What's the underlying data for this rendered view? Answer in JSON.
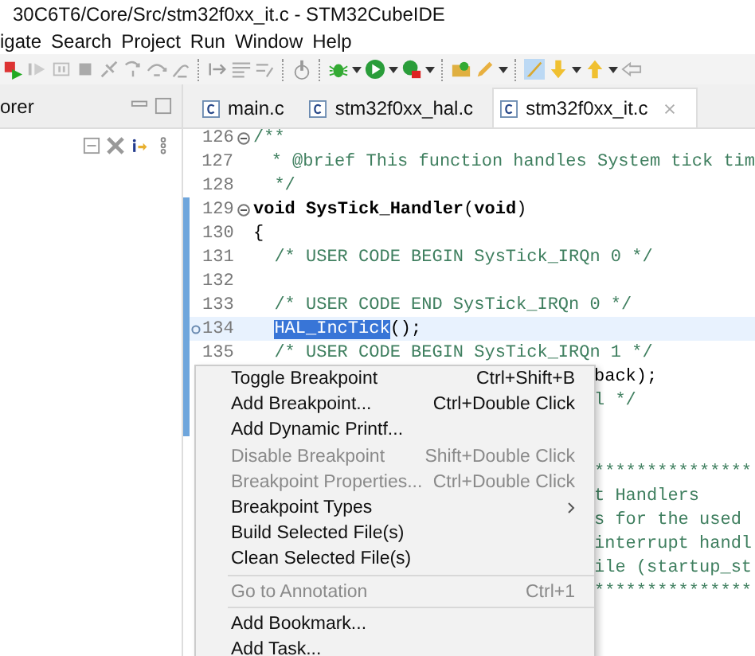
{
  "window": {
    "title": "30C6T6/Core/Src/stm32f0xx_it.c - STM32CubeIDE"
  },
  "menu_bar": [
    "igate",
    "Search",
    "Project",
    "Run",
    "Window",
    "Help"
  ],
  "left_panel": {
    "tab": "orer"
  },
  "editor_tabs": [
    {
      "label": "main.c",
      "selected": false
    },
    {
      "label": "stm32f0xx_hal.c",
      "selected": false
    },
    {
      "label": "stm32f0xx_it.c",
      "selected": true
    }
  ],
  "code_lines": [
    {
      "kind": "comment",
      "number": "126",
      "fold": true,
      "marker": false,
      "scope": false,
      "current": false,
      "text": "/**"
    },
    {
      "kind": "comment",
      "number": "127",
      "fold": false,
      "marker": false,
      "scope": false,
      "current": false,
      "text": "  * @brief This function handles System tick tim"
    },
    {
      "kind": "comment",
      "number": "128",
      "fold": false,
      "marker": false,
      "scope": false,
      "current": false,
      "text": "  */"
    },
    {
      "kind": "code",
      "number": "129",
      "fold": true,
      "marker": false,
      "scope": true,
      "current": false,
      "text": "**void** **SysTick_Handler**(**void**)"
    },
    {
      "kind": "code",
      "number": "130",
      "fold": false,
      "marker": false,
      "scope": true,
      "current": false,
      "text": "{"
    },
    {
      "kind": "comment",
      "number": "131",
      "fold": false,
      "marker": false,
      "scope": true,
      "current": false,
      "text": "  /* USER CODE BEGIN SysTick_IRQn 0 */"
    },
    {
      "kind": "blank",
      "number": "132",
      "fold": false,
      "marker": false,
      "scope": true,
      "current": false
    },
    {
      "kind": "comment",
      "number": "133",
      "fold": false,
      "marker": false,
      "scope": true,
      "current": false,
      "text": "  /* USER CODE END SysTick_IRQn 0 */"
    },
    {
      "kind": "selection",
      "number": "134",
      "fold": false,
      "marker": true,
      "scope": true,
      "current": true,
      "segments": [
        {
          "text": "HAL_IncTick",
          "selected": true
        },
        {
          "text": "();",
          "selected": false
        }
      ]
    },
    {
      "kind": "comment",
      "number": "135",
      "fold": false,
      "marker": false,
      "scope": true,
      "current": false,
      "text": "  /* USER CODE BEGIN SysTick_IRQn 1 */"
    },
    {
      "kind": "partial-code",
      "scope": true,
      "text": "back);"
    },
    {
      "kind": "partial-comment",
      "scope": true,
      "text": "l */"
    },
    {
      "kind": "partial-blank",
      "scope": true
    },
    {
      "kind": "partial-blank",
      "scope": false
    },
    {
      "kind": "partial-comment",
      "scope": false,
      "text": "***************"
    },
    {
      "kind": "partial-comment",
      "scope": false,
      "text": "t Handlers"
    },
    {
      "kind": "partial-comment",
      "scope": false,
      "text": "s for the used"
    },
    {
      "kind": "partial-comment",
      "scope": false,
      "text": "interrupt handl"
    },
    {
      "kind": "partial-comment",
      "scope": false,
      "text": "ile (startup_st"
    },
    {
      "kind": "partial-comment",
      "scope": false,
      "text": "***************"
    }
  ],
  "context_menu": [
    [
      {
        "label": "Toggle Breakpoint",
        "shortcut": "Ctrl+Shift+B",
        "disabled": false,
        "submenu": false
      },
      {
        "label": "Add Breakpoint...",
        "shortcut": "Ctrl+Double Click",
        "disabled": false,
        "submenu": false
      },
      {
        "label": "Add Dynamic Printf...",
        "disabled": false,
        "submenu": false
      },
      {
        "label": "Disable Breakpoint",
        "shortcut": "Shift+Double Click",
        "disabled": true,
        "submenu": false
      },
      {
        "label": "Breakpoint Properties...",
        "shortcut": "Ctrl+Double Click",
        "disabled": true,
        "submenu": false
      },
      {
        "label": "Breakpoint Types",
        "disabled": false,
        "submenu": true
      },
      {
        "label": "Build Selected File(s)",
        "disabled": false,
        "submenu": false
      },
      {
        "label": "Clean Selected File(s)",
        "disabled": false,
        "submenu": false
      }
    ],
    [
      {
        "label": "Go to Annotation",
        "shortcut": "Ctrl+1",
        "disabled": true,
        "submenu": false
      }
    ],
    [
      {
        "label": "Add Bookmark...",
        "disabled": false,
        "submenu": false
      },
      {
        "label": "Add Task...",
        "disabled": false,
        "submenu": false
      }
    ]
  ]
}
